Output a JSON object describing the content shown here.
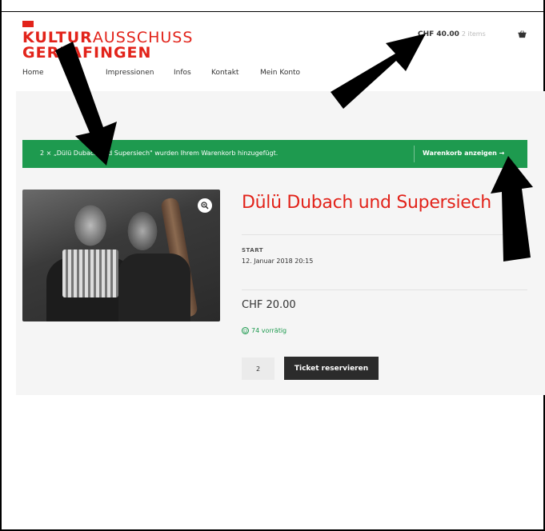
{
  "brand": {
    "line1_bold": "KULTUR",
    "line1_thin": "AUSSCHUSS",
    "line2": "GERLAFINGEN",
    "color": "#e2231a"
  },
  "header": {
    "cart_total": "CHF 40.00",
    "cart_count": "2 items",
    "cart_icon": "basket-icon"
  },
  "nav": {
    "items": [
      {
        "label": "Home"
      },
      {
        "label": "Impressionen"
      },
      {
        "label": "Infos"
      },
      {
        "label": "Kontakt"
      },
      {
        "label": "Mein Konto"
      }
    ]
  },
  "notice": {
    "message": "2 × „Dülü Dubach und Supersiech\" wurden Ihrem Warenkorb hinzugefügt.",
    "action_label": "Warenkorb anzeigen →",
    "color": "#1e9a4f"
  },
  "product": {
    "title": "Dülü Dubach und Supersiech",
    "start_label": "START",
    "start_date": "12. Januar 2018 20:15",
    "price": "CHF 20.00",
    "stock": "74 vorrätig",
    "quantity": "2",
    "button_label": "Ticket reservieren",
    "zoom_icon": "magnifier-icon"
  }
}
